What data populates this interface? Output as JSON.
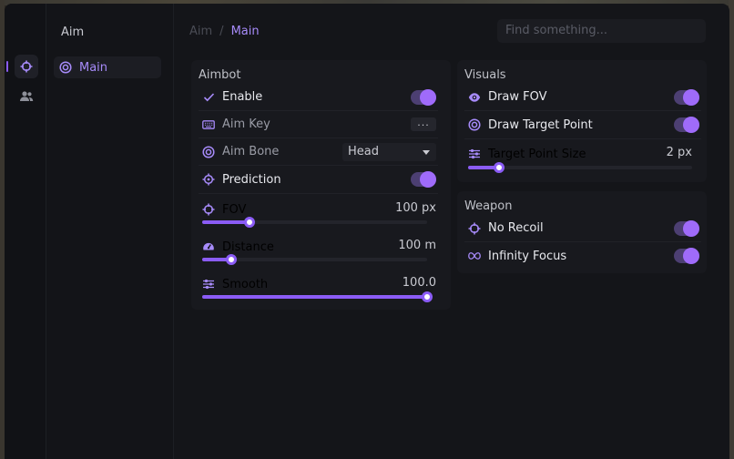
{
  "sidebar": {
    "title": "Aim",
    "items": [
      {
        "label": "Main",
        "icon": "target-icon"
      }
    ]
  },
  "iconbar": {
    "items": [
      {
        "icon": "crosshair-icon",
        "active": true
      },
      {
        "icon": "users-icon",
        "active": false
      }
    ]
  },
  "breadcrumb": {
    "parent": "Aim",
    "separator": "/",
    "current": "Main"
  },
  "search": {
    "placeholder": "Find something..."
  },
  "colors": {
    "accent": "#8b5cf6",
    "accent_light": "#a78bfa",
    "toggle_track": "#4c3f72",
    "toggle_knob": "#9f6bfa",
    "bg": "#141519",
    "panel": "#18191e"
  },
  "aimbot": {
    "title": "Aimbot",
    "enable": {
      "label": "Enable",
      "icon": "check-icon",
      "value": true
    },
    "aim_key": {
      "label": "Aim Key",
      "icon": "keyboard-icon",
      "value": "..."
    },
    "aim_bone": {
      "label": "Aim Bone",
      "icon": "target-icon",
      "value": "Head"
    },
    "prediction": {
      "label": "Prediction",
      "icon": "crosshair-target-icon",
      "value": true
    },
    "fov": {
      "label": "FOV",
      "icon": "crosshair-icon",
      "value": "100 px",
      "fraction": 0.21
    },
    "distance": {
      "label": "Distance",
      "icon": "gauge-icon",
      "value": "100 m",
      "fraction": 0.13
    },
    "smooth": {
      "label": "Smooth",
      "icon": "sliders-icon",
      "value": "100.0",
      "fraction": 1.0
    }
  },
  "visuals": {
    "title": "Visuals",
    "draw_fov": {
      "label": "Draw FOV",
      "icon": "eye-icon",
      "value": true
    },
    "draw_target_point": {
      "label": "Draw Target Point",
      "icon": "target-icon",
      "value": true
    },
    "target_point_size": {
      "label": "Target Point Size",
      "icon": "sliders-icon",
      "value": "2 px",
      "fraction": 0.14
    }
  },
  "weapon": {
    "title": "Weapon",
    "no_recoil": {
      "label": "No Recoil",
      "icon": "crosshair-icon",
      "value": true
    },
    "infinity_focus": {
      "label": "Infinity Focus",
      "icon": "infinity-icon",
      "value": true
    }
  }
}
